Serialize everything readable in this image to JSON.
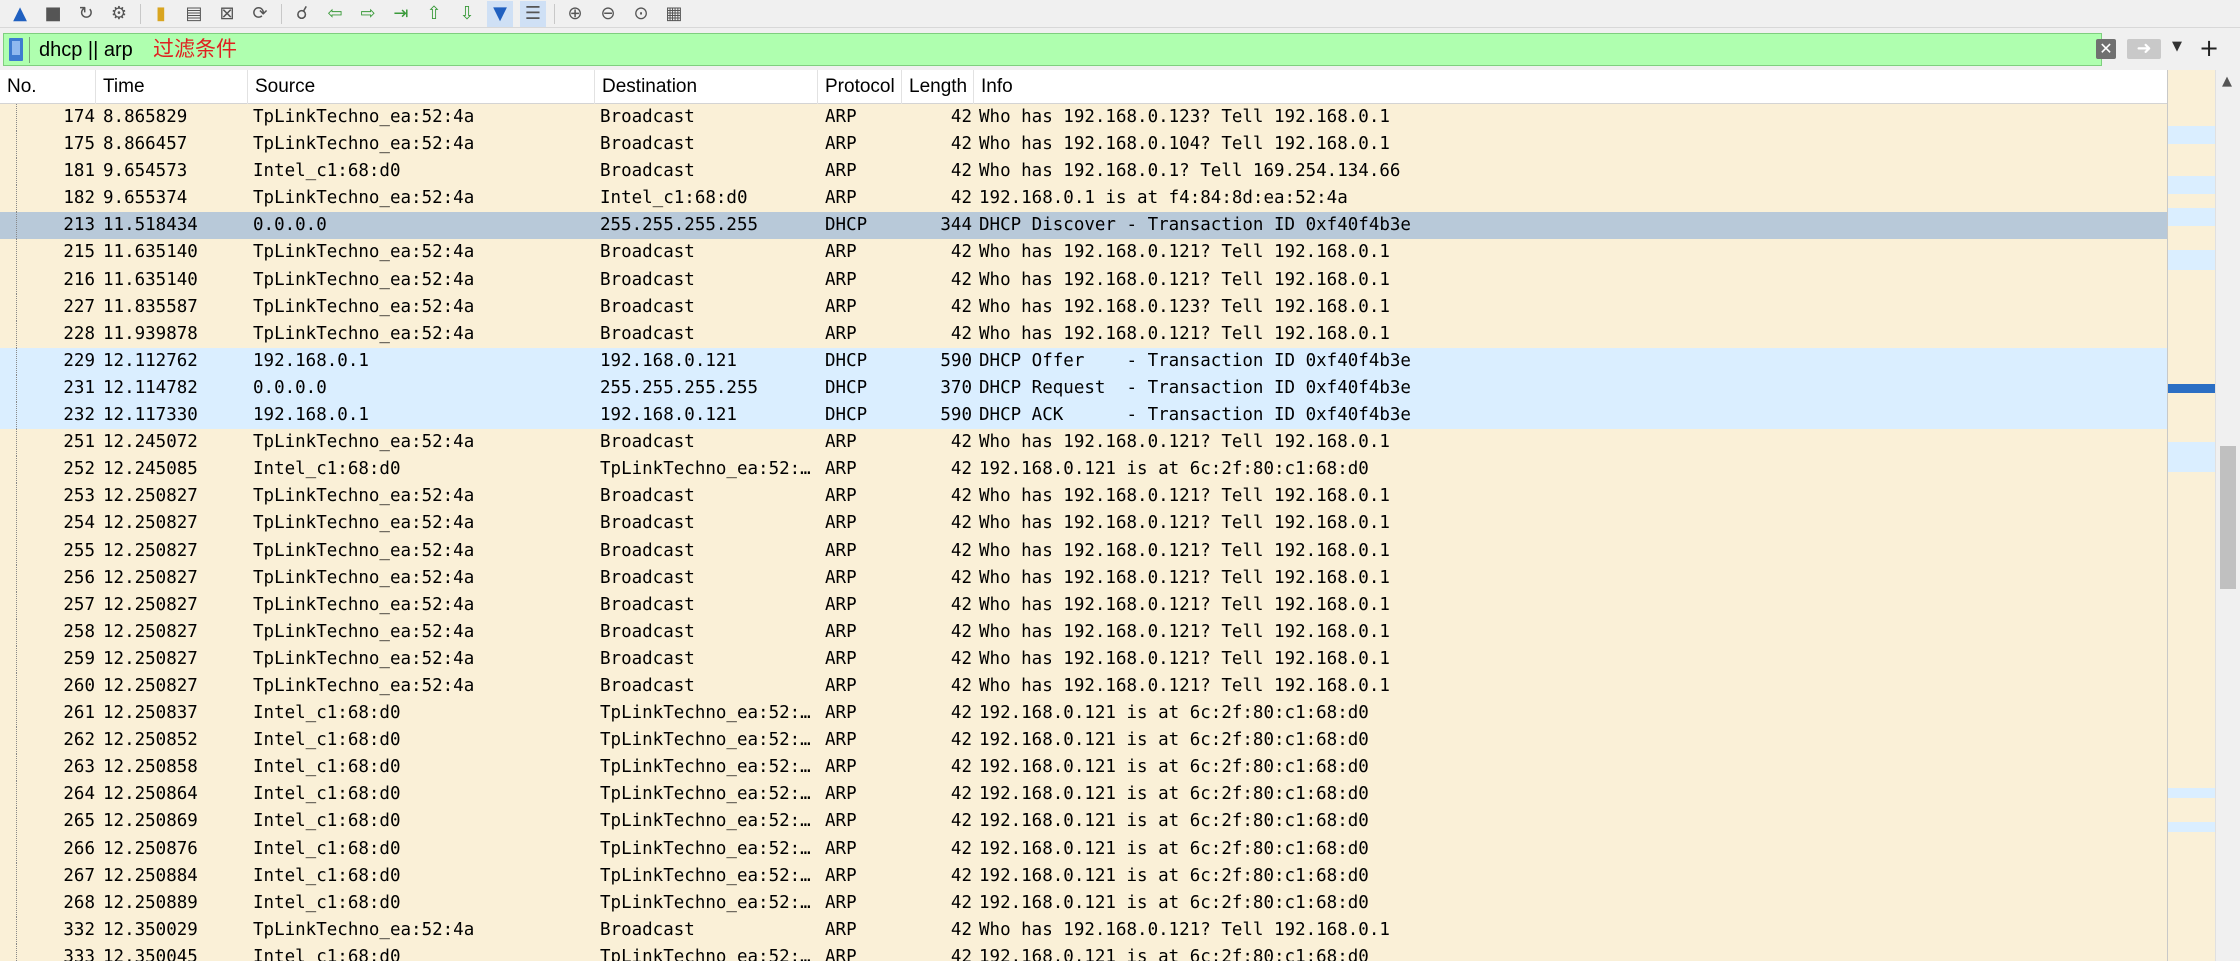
{
  "toolbar": {
    "icons": [
      "shark-fin-icon",
      "stop-icon",
      "restart-icon",
      "options-gear-icon",
      "open-folder-icon",
      "save-file-icon",
      "close-file-icon",
      "reload-icon",
      "find-icon",
      "go-back-icon",
      "go-forward-icon",
      "go-to-packet-icon",
      "first-packet-icon",
      "last-packet-icon",
      "autoscroll-icon",
      "colorize-icon",
      "zoom-in-icon",
      "zoom-out-icon",
      "normal-size-icon",
      "resize-columns-icon"
    ]
  },
  "filter": {
    "value": "dhcp || arp",
    "hint": "过滤条件",
    "bg_color": "#afffaf"
  },
  "columns": {
    "no": "No.",
    "time": "Time",
    "source": "Source",
    "destination": "Destination",
    "protocol": "Protocol",
    "length": "Length",
    "info": "Info"
  },
  "packets": [
    {
      "no": "174",
      "time": "8.865829",
      "src": "TpLinkTechno_ea:52:4a",
      "dst": "Broadcast",
      "proto": "ARP",
      "len": "42",
      "info": "Who has 192.168.0.123? Tell 192.168.0.1",
      "kind": "arp"
    },
    {
      "no": "175",
      "time": "8.866457",
      "src": "TpLinkTechno_ea:52:4a",
      "dst": "Broadcast",
      "proto": "ARP",
      "len": "42",
      "info": "Who has 192.168.0.104? Tell 192.168.0.1",
      "kind": "arp"
    },
    {
      "no": "181",
      "time": "9.654573",
      "src": "Intel_c1:68:d0",
      "dst": "Broadcast",
      "proto": "ARP",
      "len": "42",
      "info": "Who has 192.168.0.1? Tell 169.254.134.66",
      "kind": "arp"
    },
    {
      "no": "182",
      "time": "9.655374",
      "src": "TpLinkTechno_ea:52:4a",
      "dst": "Intel_c1:68:d0",
      "proto": "ARP",
      "len": "42",
      "info": "192.168.0.1 is at f4:84:8d:ea:52:4a",
      "kind": "arp"
    },
    {
      "no": "213",
      "time": "11.518434",
      "src": "0.0.0.0",
      "dst": "255.255.255.255",
      "proto": "DHCP",
      "len": "344",
      "info": "DHCP Discover - Transaction ID 0xf40f4b3e",
      "kind": "sel"
    },
    {
      "no": "215",
      "time": "11.635140",
      "src": "TpLinkTechno_ea:52:4a",
      "dst": "Broadcast",
      "proto": "ARP",
      "len": "42",
      "info": "Who has 192.168.0.121? Tell 192.168.0.1",
      "kind": "arp"
    },
    {
      "no": "216",
      "time": "11.635140",
      "src": "TpLinkTechno_ea:52:4a",
      "dst": "Broadcast",
      "proto": "ARP",
      "len": "42",
      "info": "Who has 192.168.0.121? Tell 192.168.0.1",
      "kind": "arp"
    },
    {
      "no": "227",
      "time": "11.835587",
      "src": "TpLinkTechno_ea:52:4a",
      "dst": "Broadcast",
      "proto": "ARP",
      "len": "42",
      "info": "Who has 192.168.0.123? Tell 192.168.0.1",
      "kind": "arp"
    },
    {
      "no": "228",
      "time": "11.939878",
      "src": "TpLinkTechno_ea:52:4a",
      "dst": "Broadcast",
      "proto": "ARP",
      "len": "42",
      "info": "Who has 192.168.0.121? Tell 192.168.0.1",
      "kind": "arp"
    },
    {
      "no": "229",
      "time": "12.112762",
      "src": "192.168.0.1",
      "dst": "192.168.0.121",
      "proto": "DHCP",
      "len": "590",
      "info": "DHCP Offer    - Transaction ID 0xf40f4b3e",
      "kind": "dhcp"
    },
    {
      "no": "231",
      "time": "12.114782",
      "src": "0.0.0.0",
      "dst": "255.255.255.255",
      "proto": "DHCP",
      "len": "370",
      "info": "DHCP Request  - Transaction ID 0xf40f4b3e",
      "kind": "dhcp"
    },
    {
      "no": "232",
      "time": "12.117330",
      "src": "192.168.0.1",
      "dst": "192.168.0.121",
      "proto": "DHCP",
      "len": "590",
      "info": "DHCP ACK      - Transaction ID 0xf40f4b3e",
      "kind": "dhcp"
    },
    {
      "no": "251",
      "time": "12.245072",
      "src": "TpLinkTechno_ea:52:4a",
      "dst": "Broadcast",
      "proto": "ARP",
      "len": "42",
      "info": "Who has 192.168.0.121? Tell 192.168.0.1",
      "kind": "arp"
    },
    {
      "no": "252",
      "time": "12.245085",
      "src": "Intel_c1:68:d0",
      "dst": "TpLinkTechno_ea:52:…",
      "proto": "ARP",
      "len": "42",
      "info": "192.168.0.121 is at 6c:2f:80:c1:68:d0",
      "kind": "arp"
    },
    {
      "no": "253",
      "time": "12.250827",
      "src": "TpLinkTechno_ea:52:4a",
      "dst": "Broadcast",
      "proto": "ARP",
      "len": "42",
      "info": "Who has 192.168.0.121? Tell 192.168.0.1",
      "kind": "arp"
    },
    {
      "no": "254",
      "time": "12.250827",
      "src": "TpLinkTechno_ea:52:4a",
      "dst": "Broadcast",
      "proto": "ARP",
      "len": "42",
      "info": "Who has 192.168.0.121? Tell 192.168.0.1",
      "kind": "arp"
    },
    {
      "no": "255",
      "time": "12.250827",
      "src": "TpLinkTechno_ea:52:4a",
      "dst": "Broadcast",
      "proto": "ARP",
      "len": "42",
      "info": "Who has 192.168.0.121? Tell 192.168.0.1",
      "kind": "arp"
    },
    {
      "no": "256",
      "time": "12.250827",
      "src": "TpLinkTechno_ea:52:4a",
      "dst": "Broadcast",
      "proto": "ARP",
      "len": "42",
      "info": "Who has 192.168.0.121? Tell 192.168.0.1",
      "kind": "arp"
    },
    {
      "no": "257",
      "time": "12.250827",
      "src": "TpLinkTechno_ea:52:4a",
      "dst": "Broadcast",
      "proto": "ARP",
      "len": "42",
      "info": "Who has 192.168.0.121? Tell 192.168.0.1",
      "kind": "arp"
    },
    {
      "no": "258",
      "time": "12.250827",
      "src": "TpLinkTechno_ea:52:4a",
      "dst": "Broadcast",
      "proto": "ARP",
      "len": "42",
      "info": "Who has 192.168.0.121? Tell 192.168.0.1",
      "kind": "arp"
    },
    {
      "no": "259",
      "time": "12.250827",
      "src": "TpLinkTechno_ea:52:4a",
      "dst": "Broadcast",
      "proto": "ARP",
      "len": "42",
      "info": "Who has 192.168.0.121? Tell 192.168.0.1",
      "kind": "arp"
    },
    {
      "no": "260",
      "time": "12.250827",
      "src": "TpLinkTechno_ea:52:4a",
      "dst": "Broadcast",
      "proto": "ARP",
      "len": "42",
      "info": "Who has 192.168.0.121? Tell 192.168.0.1",
      "kind": "arp"
    },
    {
      "no": "261",
      "time": "12.250837",
      "src": "Intel_c1:68:d0",
      "dst": "TpLinkTechno_ea:52:…",
      "proto": "ARP",
      "len": "42",
      "info": "192.168.0.121 is at 6c:2f:80:c1:68:d0",
      "kind": "arp"
    },
    {
      "no": "262",
      "time": "12.250852",
      "src": "Intel_c1:68:d0",
      "dst": "TpLinkTechno_ea:52:…",
      "proto": "ARP",
      "len": "42",
      "info": "192.168.0.121 is at 6c:2f:80:c1:68:d0",
      "kind": "arp"
    },
    {
      "no": "263",
      "time": "12.250858",
      "src": "Intel_c1:68:d0",
      "dst": "TpLinkTechno_ea:52:…",
      "proto": "ARP",
      "len": "42",
      "info": "192.168.0.121 is at 6c:2f:80:c1:68:d0",
      "kind": "arp"
    },
    {
      "no": "264",
      "time": "12.250864",
      "src": "Intel_c1:68:d0",
      "dst": "TpLinkTechno_ea:52:…",
      "proto": "ARP",
      "len": "42",
      "info": "192.168.0.121 is at 6c:2f:80:c1:68:d0",
      "kind": "arp"
    },
    {
      "no": "265",
      "time": "12.250869",
      "src": "Intel_c1:68:d0",
      "dst": "TpLinkTechno_ea:52:…",
      "proto": "ARP",
      "len": "42",
      "info": "192.168.0.121 is at 6c:2f:80:c1:68:d0",
      "kind": "arp"
    },
    {
      "no": "266",
      "time": "12.250876",
      "src": "Intel_c1:68:d0",
      "dst": "TpLinkTechno_ea:52:…",
      "proto": "ARP",
      "len": "42",
      "info": "192.168.0.121 is at 6c:2f:80:c1:68:d0",
      "kind": "arp"
    },
    {
      "no": "267",
      "time": "12.250884",
      "src": "Intel_c1:68:d0",
      "dst": "TpLinkTechno_ea:52:…",
      "proto": "ARP",
      "len": "42",
      "info": "192.168.0.121 is at 6c:2f:80:c1:68:d0",
      "kind": "arp"
    },
    {
      "no": "268",
      "time": "12.250889",
      "src": "Intel_c1:68:d0",
      "dst": "TpLinkTechno_ea:52:…",
      "proto": "ARP",
      "len": "42",
      "info": "192.168.0.121 is at 6c:2f:80:c1:68:d0",
      "kind": "arp"
    },
    {
      "no": "332",
      "time": "12.350029",
      "src": "TpLinkTechno_ea:52:4a",
      "dst": "Broadcast",
      "proto": "ARP",
      "len": "42",
      "info": "Who has 192.168.0.121? Tell 192.168.0.1",
      "kind": "arp"
    },
    {
      "no": "333",
      "time": "12.350045",
      "src": "Intel_c1:68:d0",
      "dst": "TpLinkTechno_ea:52:…",
      "proto": "ARP",
      "len": "42",
      "info": "192.168.0.121 is at 6c:2f:80:c1:68:d0",
      "kind": "arp"
    }
  ],
  "colors": {
    "arp_row": "#faf0d7",
    "dhcp_row": "#daeeff",
    "selected_row": "#b8c9d9"
  }
}
